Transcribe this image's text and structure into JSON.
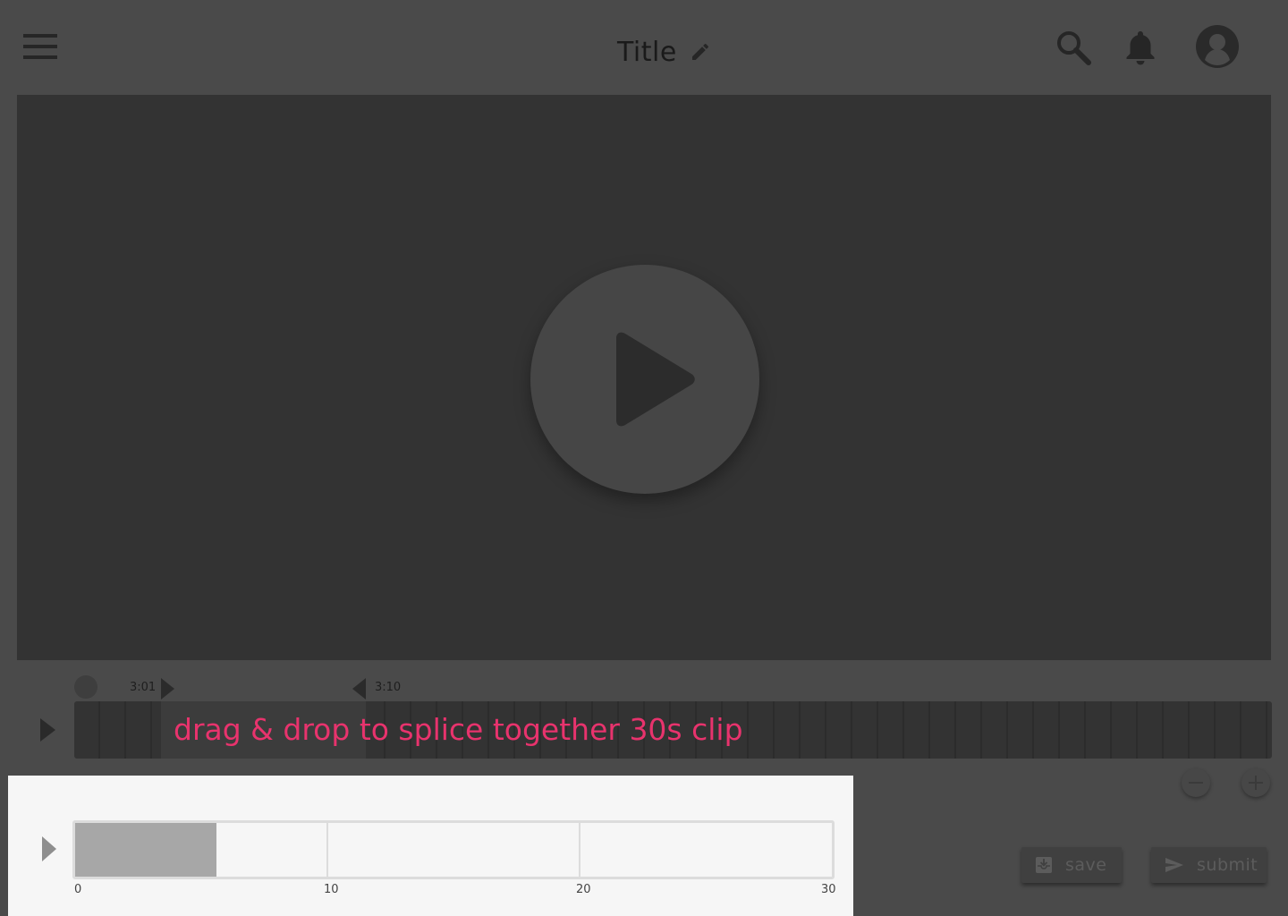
{
  "header": {
    "title": "Title"
  },
  "timeline": {
    "start_label": "3:01",
    "end_label": "3:10",
    "hint": "drag & drop to splice together 30s clip"
  },
  "clip": {
    "progress_seconds": 5.6,
    "max_seconds": 30,
    "ticks": [
      "0",
      "10",
      "20",
      "30"
    ]
  },
  "actions": {
    "save_label": "save",
    "submit_label": "submit"
  },
  "colors": {
    "background": "#4a4a4a",
    "video": "#333333",
    "hint": "#e8336d",
    "panel": "#f6f6f6",
    "clip_fill": "#a7a7a7"
  },
  "icons": {
    "menu": "hamburger-icon",
    "edit": "pencil-icon",
    "search": "search-icon",
    "notifications": "bell-icon",
    "account": "avatar-icon",
    "play": "play-icon",
    "zoom_out": "minus-icon",
    "zoom_in": "plus-icon",
    "save": "save-tray-icon",
    "submit": "send-icon"
  }
}
